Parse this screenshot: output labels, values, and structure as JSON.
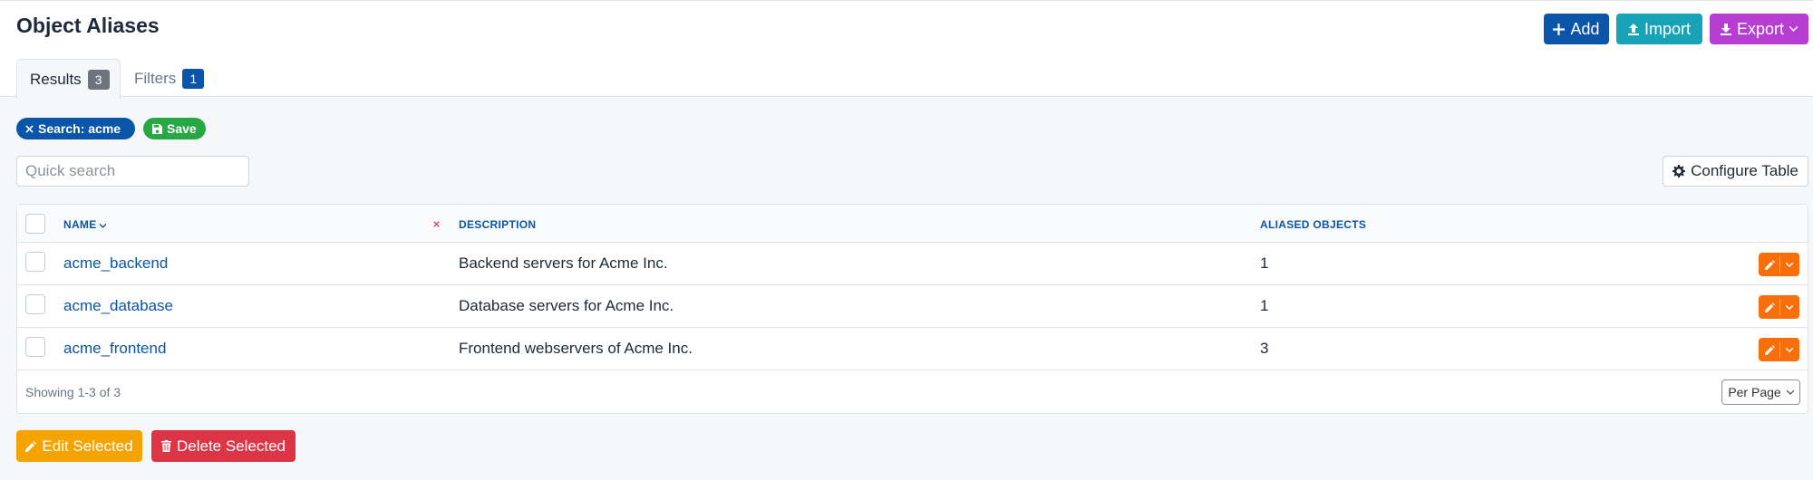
{
  "page": {
    "title": "Object Aliases"
  },
  "toolbar": {
    "add_label": "Add",
    "import_label": "Import",
    "export_label": "Export"
  },
  "tabs": [
    {
      "label": "Results",
      "count": "3",
      "active": true
    },
    {
      "label": "Filters",
      "count": "1",
      "active": false
    }
  ],
  "filters": {
    "search_pill": "Search: acme",
    "save_label": "Save"
  },
  "search": {
    "placeholder": "Quick search",
    "value": ""
  },
  "configure_label": "Configure Table",
  "table": {
    "columns": {
      "name": "NAME",
      "description": "DESCRIPTION",
      "aliased": "ALIASED OBJECTS"
    },
    "rows": [
      {
        "name": "acme_backend",
        "description": "Backend servers for Acme Inc.",
        "aliased": "1"
      },
      {
        "name": "acme_database",
        "description": "Database servers for Acme Inc.",
        "aliased": "1"
      },
      {
        "name": "acme_frontend",
        "description": "Frontend webservers of Acme Inc.",
        "aliased": "3"
      }
    ],
    "showing": "Showing 1-3 of 3",
    "per_page": "Per Page"
  },
  "bulk": {
    "edit_label": "Edit Selected",
    "delete_label": "Delete Selected"
  },
  "colors": {
    "primary": "#0b55a8",
    "info": "#17a2b8",
    "purple": "#b63ed1",
    "success": "#28a745",
    "warning": "#f5a300",
    "orange": "#f86e0b",
    "danger": "#dc3545"
  }
}
